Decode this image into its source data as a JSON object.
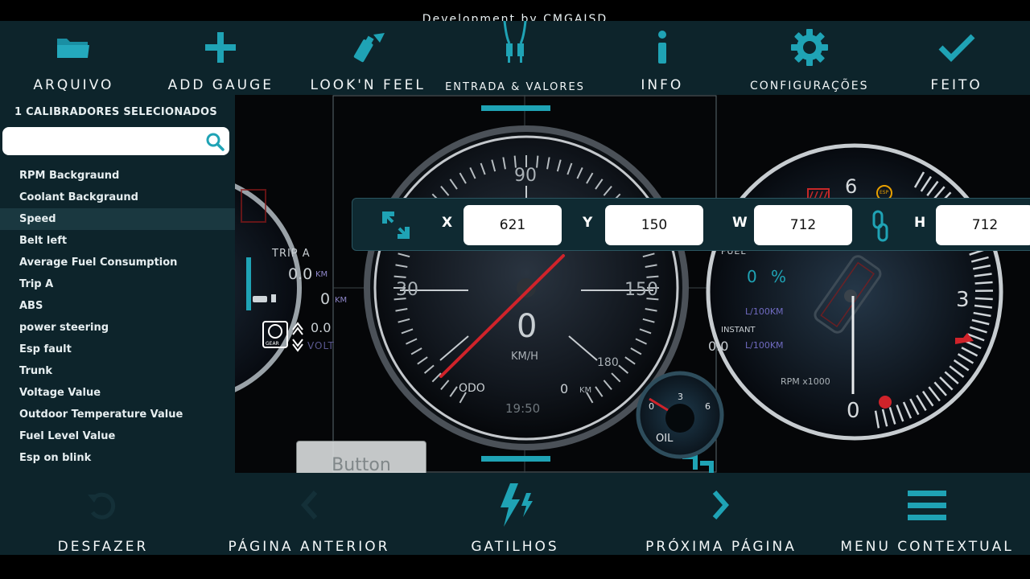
{
  "credit": "Development by CMGAISD",
  "toolbar": {
    "items": [
      {
        "label": "ARQUIVO",
        "icon": "folder-icon"
      },
      {
        "label": "ADD GAUGE",
        "icon": "plus-icon"
      },
      {
        "label": "LOOK'N FEEL",
        "icon": "spray-paint-icon"
      },
      {
        "label": "ENTRADA & VALORES",
        "icon": "cable-plug-icon"
      },
      {
        "label": "INFO",
        "icon": "info-icon"
      },
      {
        "label": "CONFIGURAÇÕES",
        "icon": "gear-icon"
      },
      {
        "label": "FEITO",
        "icon": "checkmark-icon"
      }
    ]
  },
  "sidebar": {
    "title": "1 CALIBRADORES SELECIONADOS",
    "search_value": "",
    "items": [
      {
        "label": "RPM Backgraund"
      },
      {
        "label": "Coolant Backgraund"
      },
      {
        "label": "Speed",
        "selected": true
      },
      {
        "label": "Belt left"
      },
      {
        "label": "Average Fuel Consumption"
      },
      {
        "label": "Trip A"
      },
      {
        "label": "ABS"
      },
      {
        "label": "power steering"
      },
      {
        "label": "Esp fault"
      },
      {
        "label": "Trunk"
      },
      {
        "label": "Voltage Value"
      },
      {
        "label": "Outdoor Temperature Value"
      },
      {
        "label": "Fuel Level Value"
      },
      {
        "label": "Esp on blink"
      }
    ]
  },
  "position_bar": {
    "x_label": "X",
    "x_value": "621",
    "y_label": "Y",
    "y_value": "150",
    "w_label": "W",
    "w_value": "712",
    "h_label": "H",
    "h_value": "712"
  },
  "dashboard": {
    "left": {
      "trip_label": "TRIP A",
      "trip_value": "0.0",
      "trip_unit": "KM",
      "range_value": "0",
      "range_unit": "KM",
      "gear_label": "GEAR",
      "volt_value": "0.0",
      "volt_unit": "VOLT"
    },
    "speedo": {
      "tick_90": "90",
      "tick_30": "30",
      "tick_150": "150",
      "tick_180": "180",
      "speed_value": "0",
      "speed_unit": "KM/H",
      "odo_label": "ODO",
      "odo_value": "0",
      "odo_unit": "KM",
      "clock": "19:50"
    },
    "oil": {
      "tick_0": "0",
      "tick_3": "3",
      "tick_6": "6",
      "label": "OIL"
    },
    "right": {
      "tick_6": "6",
      "tick_3": "3",
      "tick_0": "0",
      "rpm_label": "RPM x1000",
      "fuel_label": "FUEL",
      "fuel_value": "0",
      "fuel_unit": "%",
      "avg_unit": "L/100KM",
      "instant_label": "INSTANT",
      "instant_value": "0.0",
      "instant_unit": "L/100KM",
      "esp_badge": "ESP"
    },
    "ghost_button": "Button"
  },
  "bottombar": {
    "items": [
      {
        "label": "DESFAZER",
        "icon": "undo-icon"
      },
      {
        "label": "PÁGINA ANTERIOR",
        "icon": "chevron-left-icon"
      },
      {
        "label": "GATILHOS",
        "icon": "lightning-icon"
      },
      {
        "label": "PRÓXIMA PÁGINA",
        "icon": "chevron-right-icon"
      },
      {
        "label": "MENU CONTEXTUAL",
        "icon": "hamburger-menu-icon"
      }
    ]
  },
  "colors": {
    "accent": "#1fa3b5",
    "panel": "#0d242b",
    "needle": "#d0232a",
    "selected_row": "#1a3840"
  }
}
